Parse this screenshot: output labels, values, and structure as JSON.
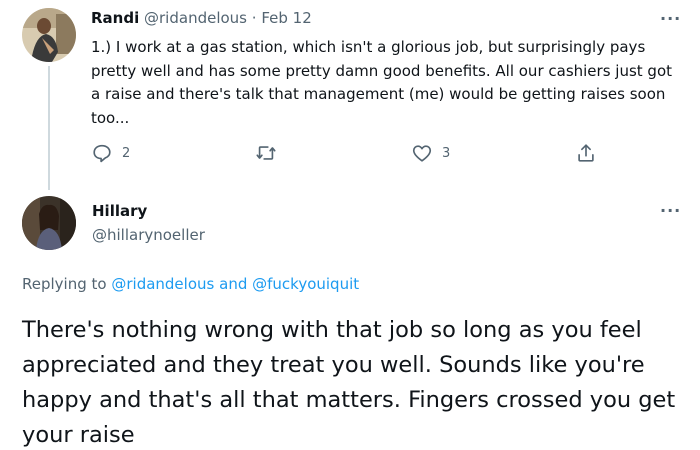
{
  "tweet1": {
    "author_name": "Randi",
    "author_handle": "@ridandelous",
    "separator": "·",
    "date": "Feb 12",
    "text": "1.) I work at a gas station, which isn't a glorious job, but surprisingly pays pretty well and has some pretty damn good benefits. All our cashiers just got a raise and there's talk that management (me) would be getting raises soon too...",
    "more_label": "···",
    "actions": {
      "reply_icon": "comment-icon",
      "reply_count": "2",
      "retweet_icon": "retweet-icon",
      "like_icon": "heart-icon",
      "like_count": "3",
      "share_icon": "share-icon"
    }
  },
  "tweet2": {
    "author_name": "Hillary",
    "author_handle": "@hillarynoeller",
    "more_label": "···",
    "replying_prefix": "Replying to",
    "replying_to_1": "@ridandelous",
    "replying_and": "and",
    "replying_to_2": "@fuckyouiquit",
    "text": "There's nothing wrong with that job so long as you feel appreciated and they treat you well. Sounds like you're happy and that's all that matters. Fingers crossed you get your raise"
  },
  "colors": {
    "text_primary": "#0f1419",
    "text_secondary": "#536471",
    "link": "#1d9bf0",
    "thread_line": "#cfd9de"
  }
}
